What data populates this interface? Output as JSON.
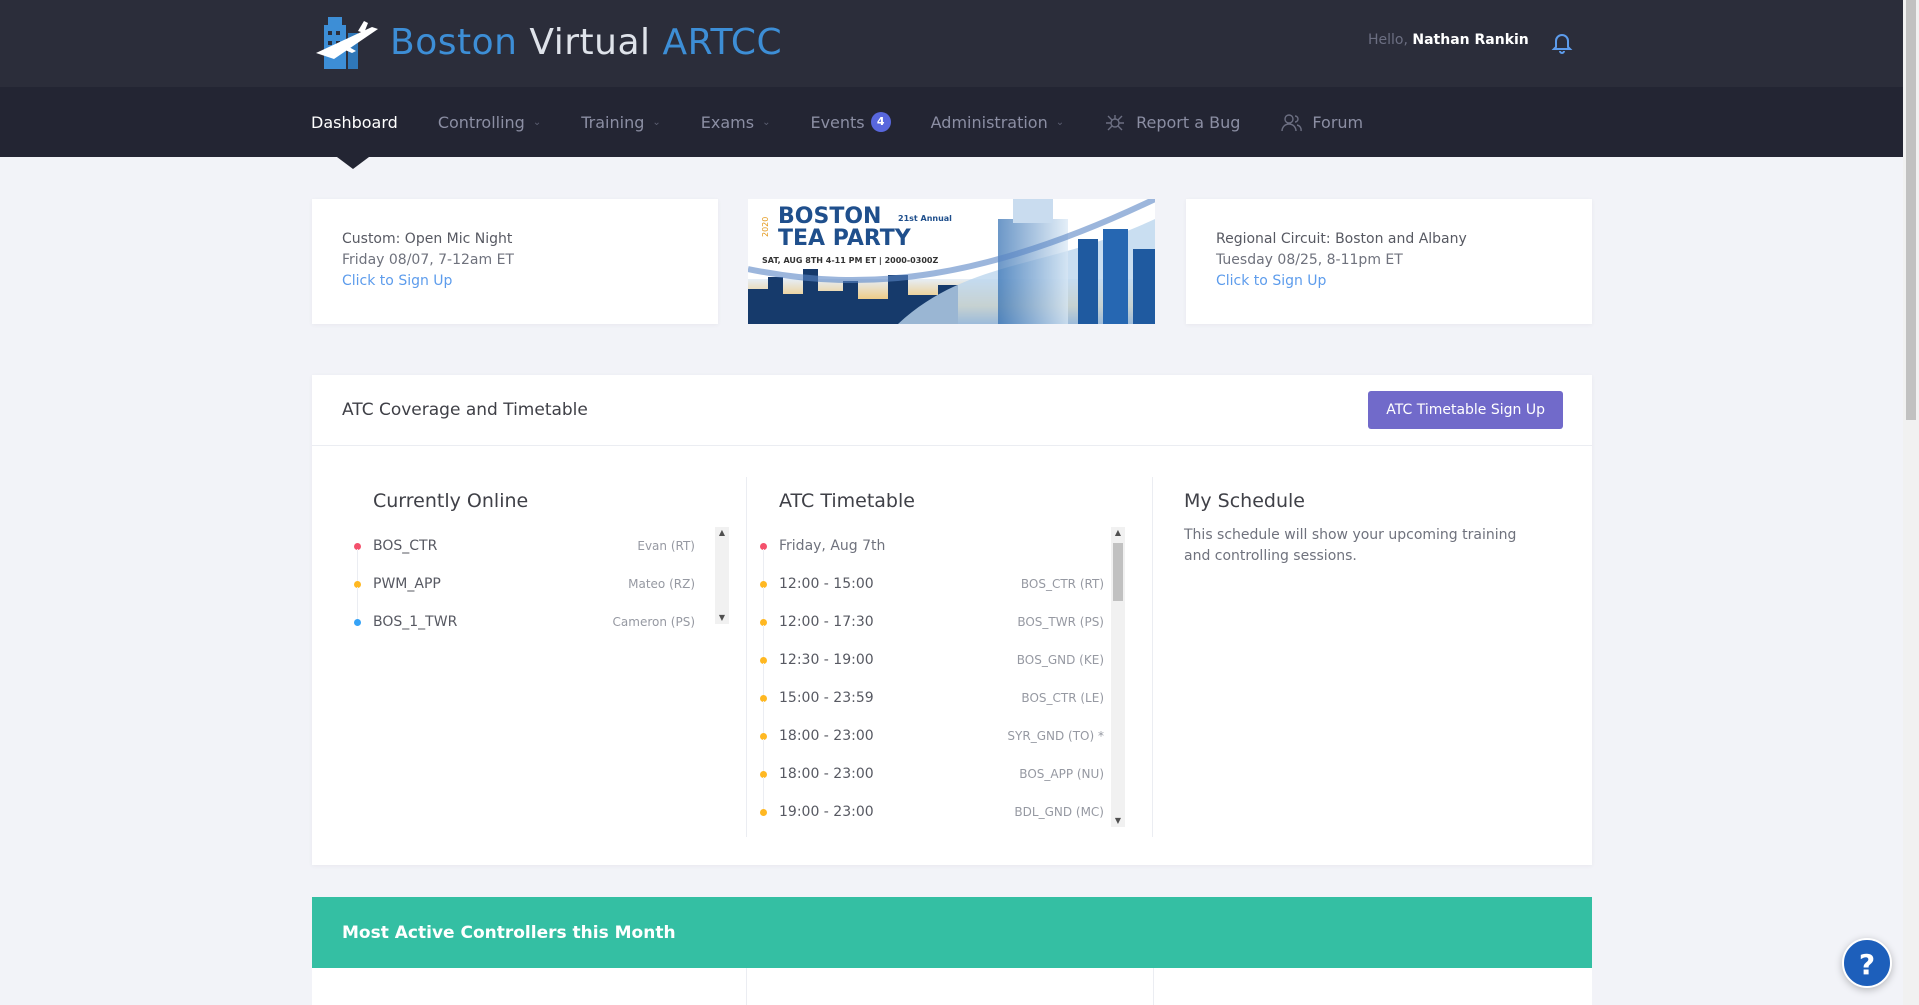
{
  "header": {
    "brand": [
      "Boston",
      "Virtual",
      "ARTCC"
    ],
    "greeting": "Hello,",
    "user_name": "Nathan Rankin"
  },
  "nav": {
    "items": [
      {
        "label": "Dashboard",
        "active": true,
        "dropdown": false
      },
      {
        "label": "Controlling",
        "dropdown": true
      },
      {
        "label": "Training",
        "dropdown": true
      },
      {
        "label": "Exams",
        "dropdown": true
      },
      {
        "label": "Events",
        "badge": "4",
        "dropdown": false
      },
      {
        "label": "Administration",
        "dropdown": true
      },
      {
        "label": "Report a Bug",
        "icon": "bug-icon"
      },
      {
        "label": "Forum",
        "icon": "forum-icon"
      }
    ]
  },
  "events": {
    "left": {
      "title": "Custom: Open Mic Night",
      "date": "Friday 08/07, 7-12am ET",
      "link": "Click to Sign Up"
    },
    "banner": {
      "year": "2020",
      "line1": "BOSTON",
      "line2": "TEA PARTY",
      "annual": "21st Annual",
      "details": "SAT, AUG 8TH 4-11 PM ET | 2000-0300Z"
    },
    "right": {
      "title": "Regional Circuit: Boston and Albany",
      "date": "Tuesday 08/25, 8-11pm ET",
      "link": "Click to Sign Up"
    }
  },
  "atc": {
    "title": "ATC Coverage and Timetable",
    "signup_button": "ATC Timetable Sign Up",
    "online": {
      "heading": "Currently Online",
      "rows": [
        {
          "position": "BOS_CTR",
          "controller": "Evan (RT)",
          "color": "#f4516c"
        },
        {
          "position": "PWM_APP",
          "controller": "Mateo (RZ)",
          "color": "#ffb822"
        },
        {
          "position": "BOS_1_TWR",
          "controller": "Cameron (PS)",
          "color": "#36a3f7"
        }
      ]
    },
    "timetable": {
      "heading": "ATC Timetable",
      "date": "Friday, Aug 7th",
      "rows": [
        {
          "time": "12:00 - 15:00",
          "position": "BOS_CTR (RT)"
        },
        {
          "time": "12:00 - 17:30",
          "position": "BOS_TWR (PS)"
        },
        {
          "time": "12:30 - 19:00",
          "position": "BOS_GND (KE)"
        },
        {
          "time": "15:00 - 23:59",
          "position": "BOS_CTR (LE)"
        },
        {
          "time": "18:00 - 23:00",
          "position": "SYR_GND (TO) *"
        },
        {
          "time": "18:00 - 23:00",
          "position": "BOS_APP (NU)"
        },
        {
          "time": "19:00 - 23:00",
          "position": "BDL_GND (MC)"
        }
      ]
    },
    "schedule": {
      "heading": "My Schedule",
      "text": "This schedule will show your upcoming training and controlling sessions."
    }
  },
  "most_active": {
    "title": "Most Active Controllers this Month"
  },
  "help": {
    "label": "?"
  },
  "colors": {
    "accent": "#716aca",
    "teal": "#34bfa3",
    "dark": "#2b2d3a",
    "link": "#5d9cec"
  }
}
